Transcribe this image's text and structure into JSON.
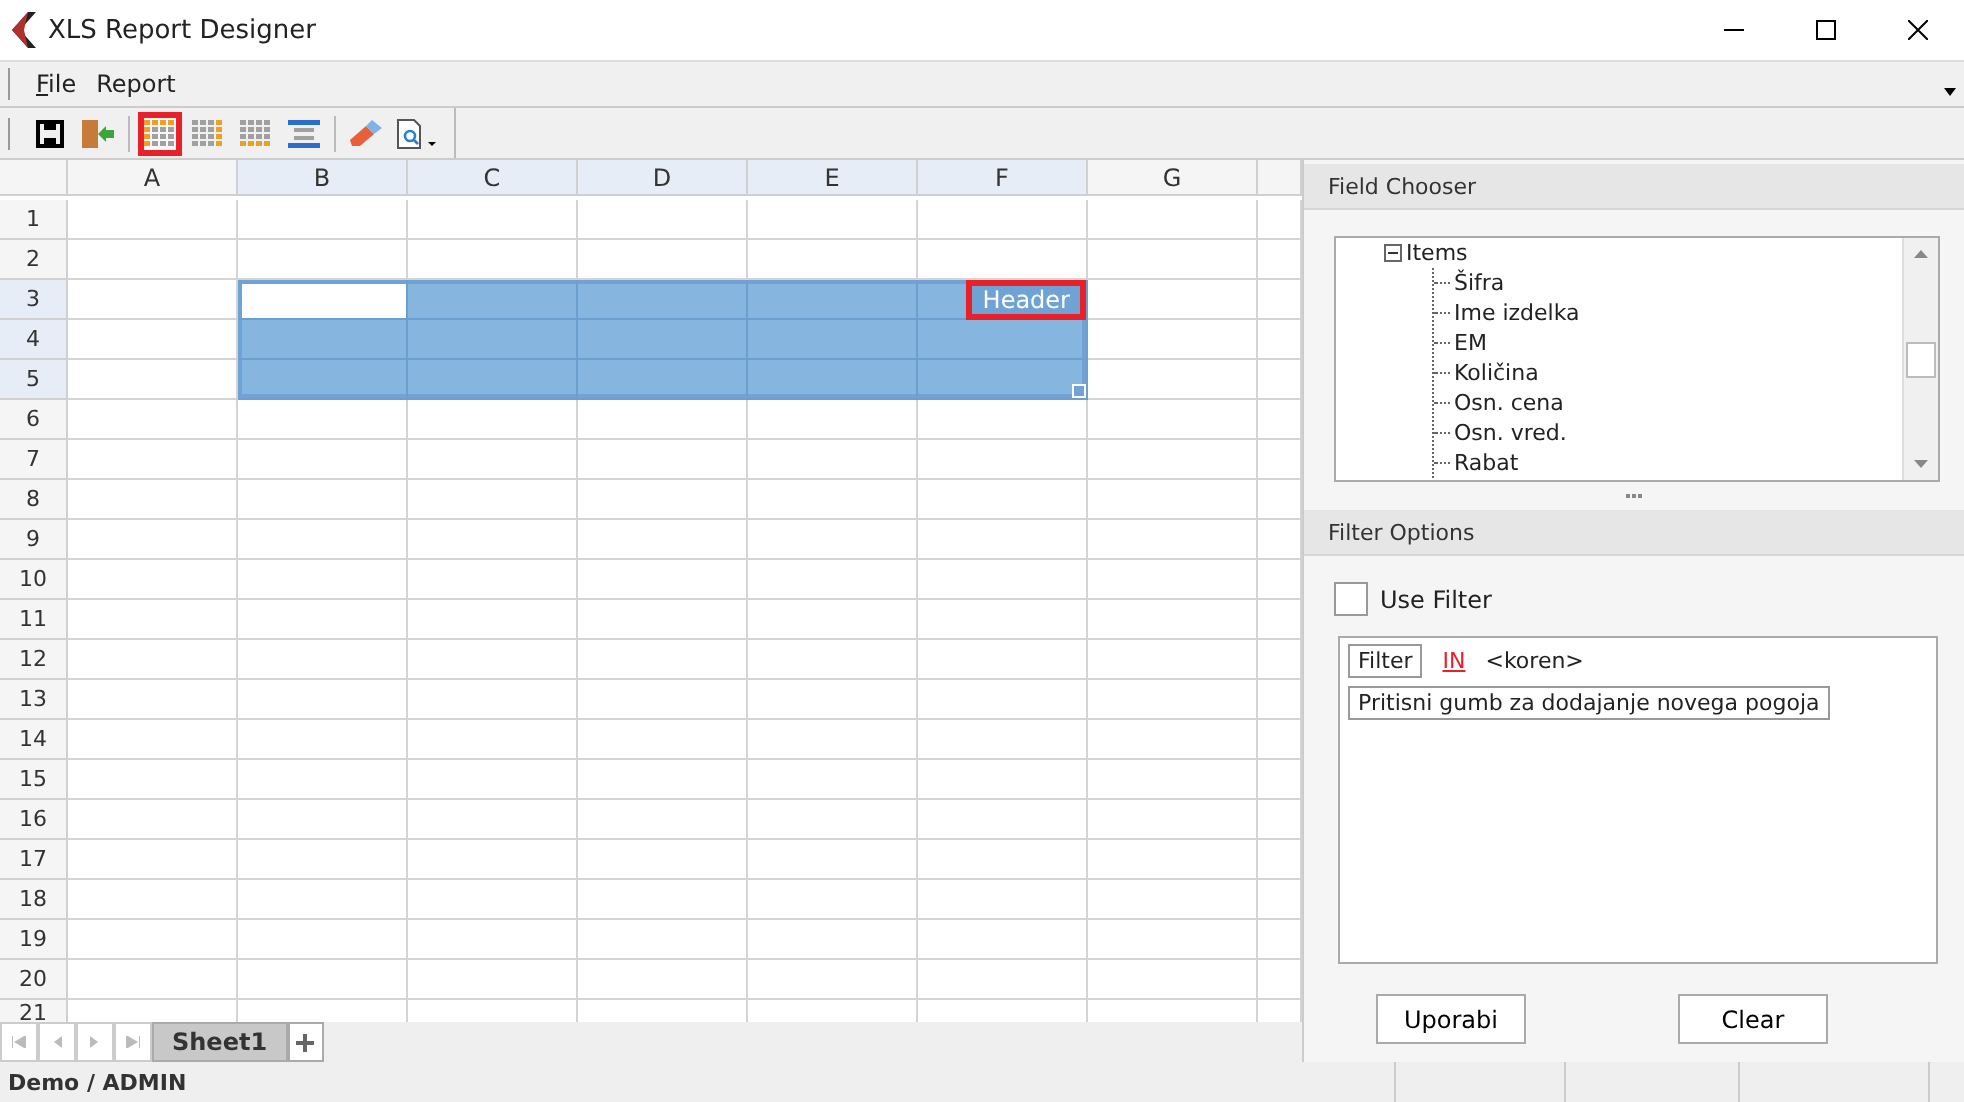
{
  "window": {
    "title": "XLS Report Designer"
  },
  "menu": [
    {
      "label": "File"
    },
    {
      "label": "Report"
    }
  ],
  "toolbar": [
    {
      "kind": "save",
      "highlighted": false
    },
    {
      "kind": "exit",
      "highlighted": false
    },
    {
      "kind": "sep"
    },
    {
      "kind": "grid-all",
      "highlighted": true
    },
    {
      "kind": "grid-right",
      "highlighted": false
    },
    {
      "kind": "grid-bottom",
      "highlighted": false
    },
    {
      "kind": "lines",
      "highlighted": false
    },
    {
      "kind": "sep"
    },
    {
      "kind": "eraser",
      "highlighted": false
    },
    {
      "kind": "preview",
      "highlighted": false
    }
  ],
  "sheet": {
    "columns": [
      {
        "label": "A",
        "selected": false
      },
      {
        "label": "B",
        "selected": true
      },
      {
        "label": "C",
        "selected": true
      },
      {
        "label": "D",
        "selected": true
      },
      {
        "label": "E",
        "selected": true
      },
      {
        "label": "F",
        "selected": true
      },
      {
        "label": "G",
        "selected": false
      }
    ],
    "rows": [
      {
        "label": "1",
        "selected": false
      },
      {
        "label": "2",
        "selected": false
      },
      {
        "label": "3",
        "selected": true
      },
      {
        "label": "4",
        "selected": true
      },
      {
        "label": "5",
        "selected": true
      },
      {
        "label": "6",
        "selected": false
      },
      {
        "label": "7",
        "selected": false
      },
      {
        "label": "8",
        "selected": false
      },
      {
        "label": "9",
        "selected": false
      },
      {
        "label": "10",
        "selected": false
      },
      {
        "label": "11",
        "selected": false
      },
      {
        "label": "12",
        "selected": false
      },
      {
        "label": "13",
        "selected": false
      },
      {
        "label": "14",
        "selected": false
      },
      {
        "label": "15",
        "selected": false
      },
      {
        "label": "16",
        "selected": false
      },
      {
        "label": "17",
        "selected": false
      },
      {
        "label": "18",
        "selected": false
      },
      {
        "label": "19",
        "selected": false
      },
      {
        "label": "20",
        "selected": false
      },
      {
        "label": "21",
        "selected": false
      }
    ],
    "header": {
      "label": "Header",
      "highlighted": true
    }
  },
  "sheet_tabs": [
    {
      "label": "Sheet1",
      "selected": true
    }
  ],
  "field_chooser": {
    "title": "Field Chooser",
    "tree": [
      {
        "label": "Items",
        "expanded": true,
        "children": [
          {
            "label": "Šifra"
          },
          {
            "label": "Ime izdelka"
          },
          {
            "label": "EM"
          },
          {
            "label": "Količina"
          },
          {
            "label": "Osn. cena"
          },
          {
            "label": "Osn. vred."
          },
          {
            "label": "Rabat"
          }
        ]
      }
    ]
  },
  "filter_options": {
    "title": "Filter Options",
    "use_filter": {
      "label": "Use Filter",
      "checked": false
    },
    "filter": {
      "button": "Filter",
      "operator": "IN",
      "target": "<koren>",
      "hint": "Pritisni gumb za dodajanje novega pogoja"
    },
    "buttons": [
      "Uporabi",
      "Clear"
    ]
  },
  "status_bar": {
    "user": "Demo / ADMIN"
  }
}
